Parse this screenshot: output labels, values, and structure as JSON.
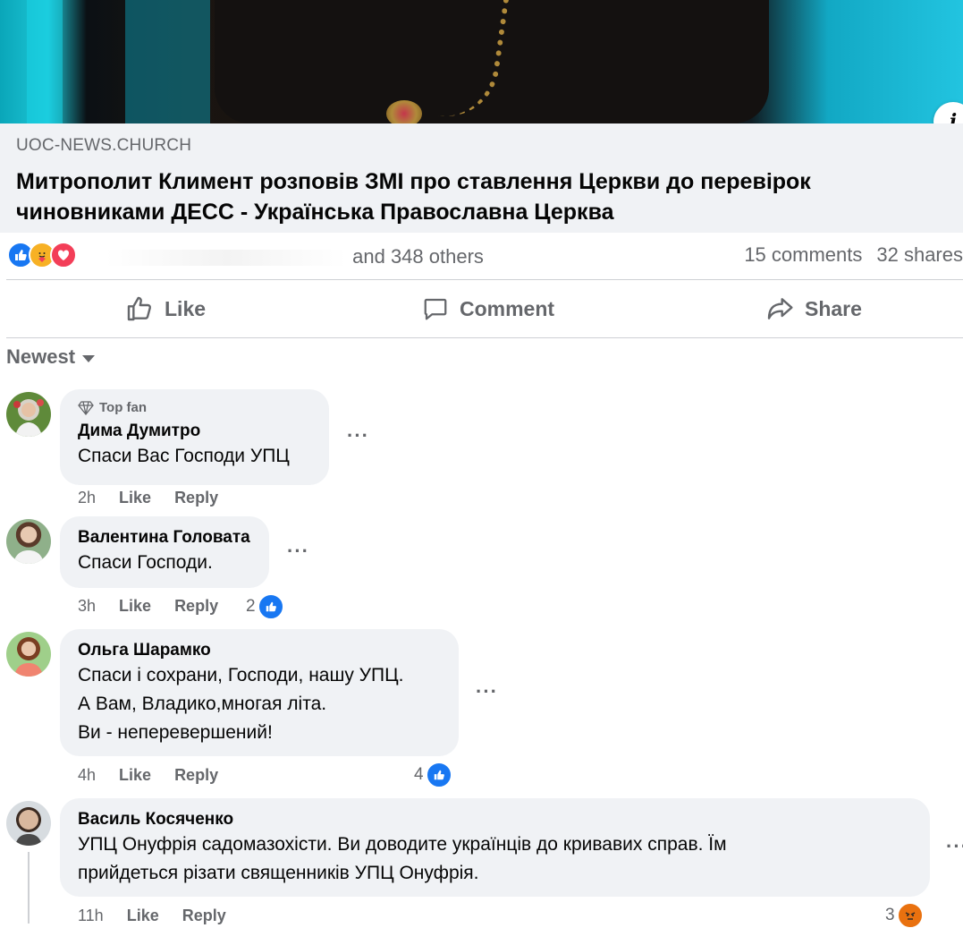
{
  "link_preview": {
    "domain": "UOC-NEWS.CHURCH",
    "title": "Митрополит Климент розповів ЗМІ про ставлення Церкви до перевірок чиновниками ДЕСС - Українська Православна Церква",
    "info_icon": "info-icon"
  },
  "reactions": {
    "icons": [
      "like",
      "care",
      "love"
    ],
    "others_text": "and 348 others",
    "comments_count": "15 comments",
    "shares_count": "32 shares"
  },
  "actions": {
    "like_label": "Like",
    "comment_label": "Comment",
    "share_label": "Share"
  },
  "sort": {
    "label": "Newest"
  },
  "comments": [
    {
      "badge": "Top fan",
      "name": "Дима Думитро",
      "lines": [
        "Спаси Вас Господи УПЦ"
      ],
      "time": "2h",
      "like": "Like",
      "reply": "Reply",
      "reaction_count": "",
      "reaction": ""
    },
    {
      "badge": "",
      "name": "Валентина Головата",
      "lines": [
        "Спаси Господи."
      ],
      "time": "3h",
      "like": "Like",
      "reply": "Reply",
      "reaction_count": "2",
      "reaction": "like"
    },
    {
      "badge": "",
      "name": "Ольга Шарамко",
      "lines": [
        "Спаси і сохрани, Господи, нашу УПЦ.",
        "А Вам, Владико,многая літа.",
        "Ви - неперевершений!"
      ],
      "time": "4h",
      "like": "Like",
      "reply": "Reply",
      "reaction_count": "4",
      "reaction": "like"
    },
    {
      "badge": "",
      "name": "Василь Косяченко",
      "lines": [
        "УПЦ Онуфрія садомазохісти. Ви доводите українців до кривавих справ. Їм",
        "прийдеться різати священників УПЦ Онуфрія."
      ],
      "time": "11h",
      "like": "Like",
      "reply": "Reply",
      "reaction_count": "3",
      "reaction": "angry"
    }
  ],
  "colors": {
    "secondary_text": "#65676b",
    "bubble_bg": "#f0f2f5",
    "like_blue": "#1877f2",
    "love_red": "#f33e58",
    "angry_orange": "#e9710f"
  }
}
